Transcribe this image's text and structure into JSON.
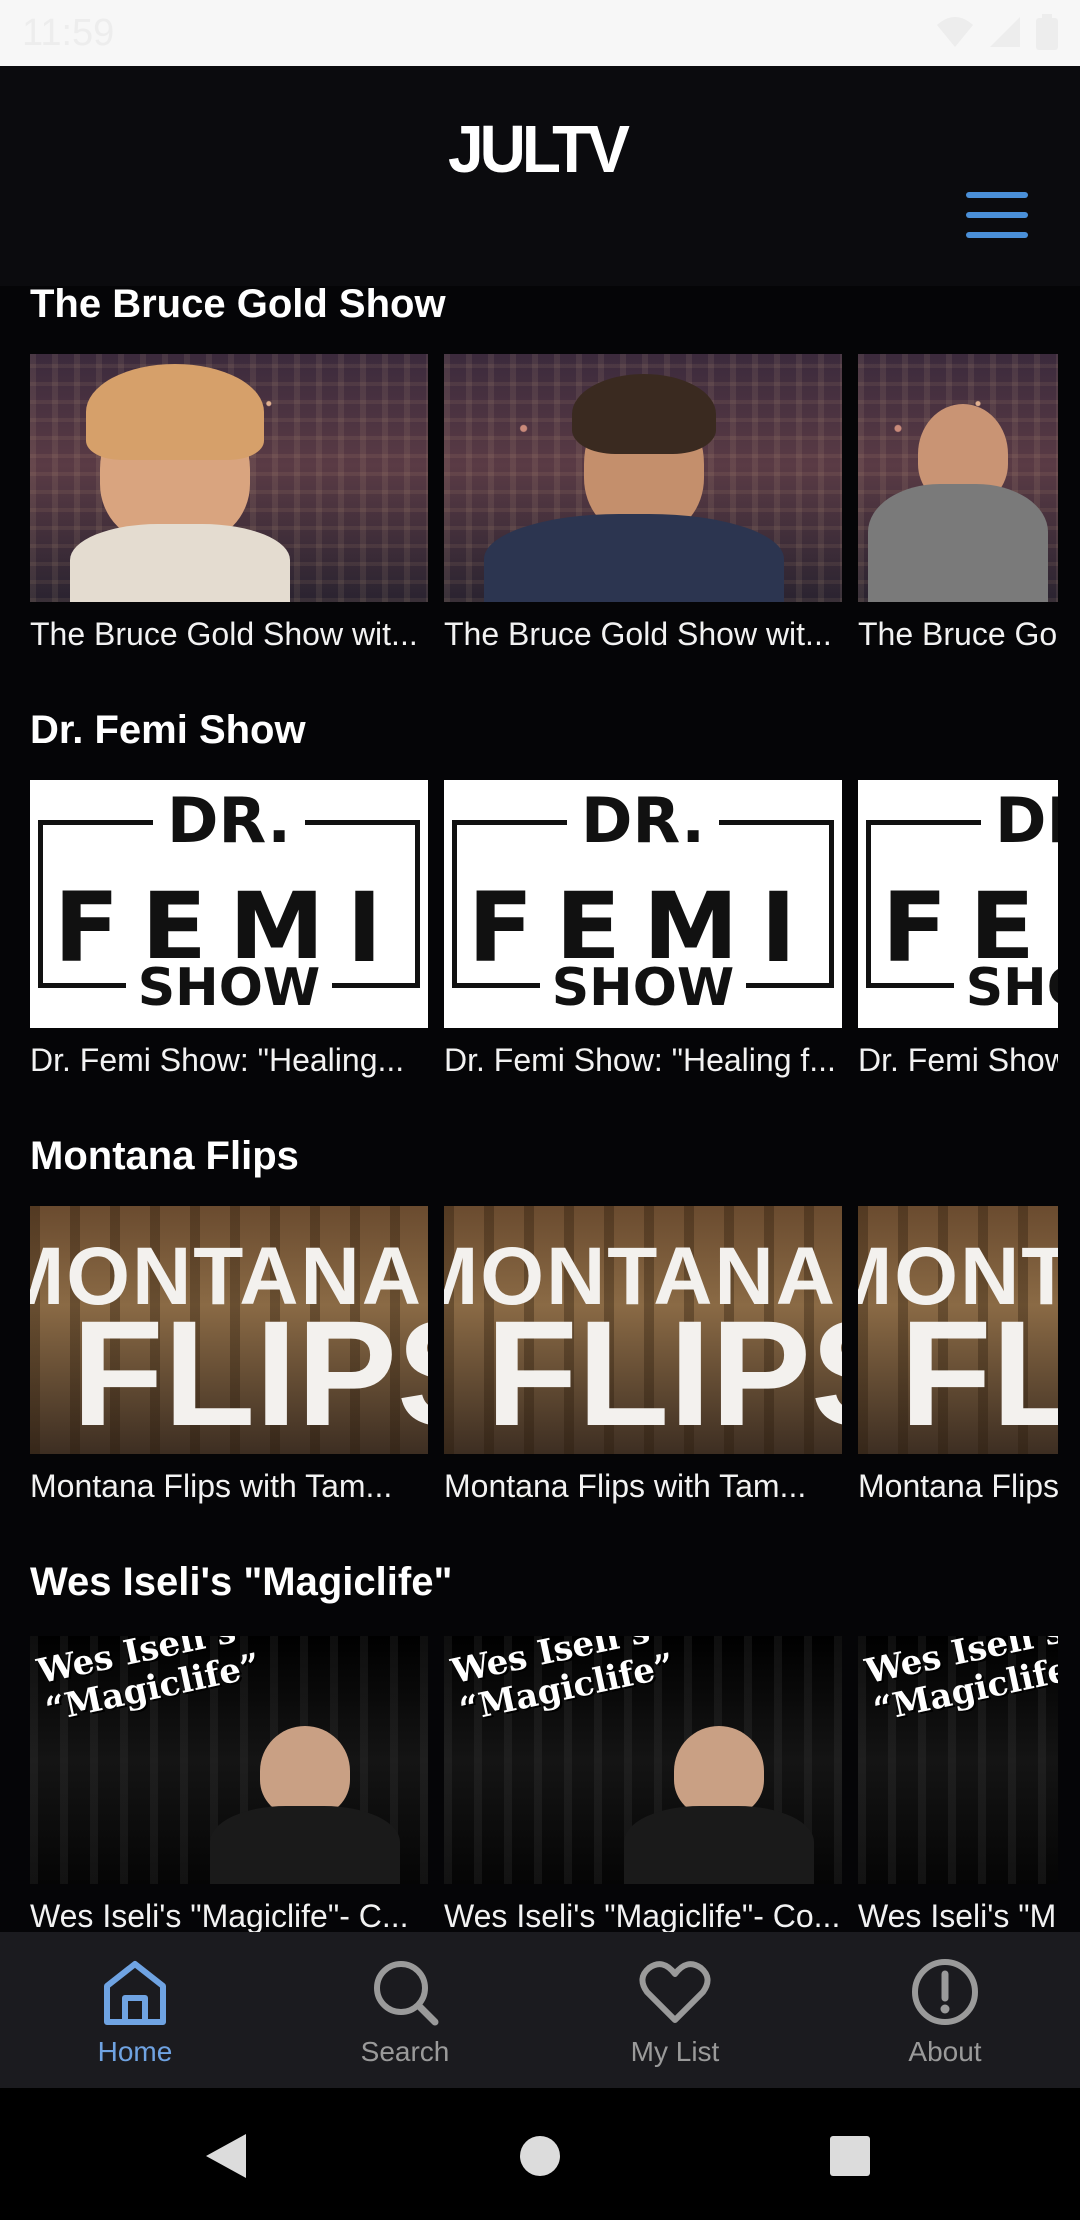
{
  "status_bar": {
    "time": "11:59"
  },
  "header": {
    "logo_text": "JULTV"
  },
  "sections": [
    {
      "title": "The Bruce Gold Show",
      "items": [
        {
          "title": "The Bruce Gold Show wit..."
        },
        {
          "title": "The Bruce Gold Show wit..."
        },
        {
          "title": "The Bruce Go"
        }
      ]
    },
    {
      "title": "Dr. Femi Show",
      "thumb_text": {
        "top": "DR.",
        "main": "FEMI",
        "bottom": "SHOW"
      },
      "items": [
        {
          "title": "Dr. Femi Show: \"Healing..."
        },
        {
          "title": "Dr. Femi Show: \"Healing f..."
        },
        {
          "title": "Dr. Femi Show"
        }
      ]
    },
    {
      "title": "Montana Flips",
      "thumb_text": {
        "top": "MONTANA",
        "main": "FLIPS"
      },
      "items": [
        {
          "title": "Montana Flips with Tam..."
        },
        {
          "title": "Montana Flips with Tam..."
        },
        {
          "title": "Montana Flips"
        }
      ]
    },
    {
      "title": "Wes Iseli's \"Magiclife\"",
      "thumb_text": {
        "line1": "Wes Iseli’s",
        "line2": "“Magiclife”"
      },
      "items": [
        {
          "title": "Wes Iseli's \"Magiclife\"-  C..."
        },
        {
          "title": "Wes Iseli's \"Magiclife\"- Co..."
        },
        {
          "title": "Wes Iseli's \"M"
        }
      ]
    }
  ],
  "bottom_nav": [
    {
      "label": "Home",
      "icon": "home-icon",
      "active": true
    },
    {
      "label": "Search",
      "icon": "search-icon",
      "active": false
    },
    {
      "label": "My List",
      "icon": "heart-icon",
      "active": false
    },
    {
      "label": "About",
      "icon": "info-icon",
      "active": false
    }
  ],
  "colors": {
    "accent": "#6fa3e2",
    "menu": "#4a8fd8",
    "background": "#050507",
    "nav_bg": "#1b1b1f"
  }
}
